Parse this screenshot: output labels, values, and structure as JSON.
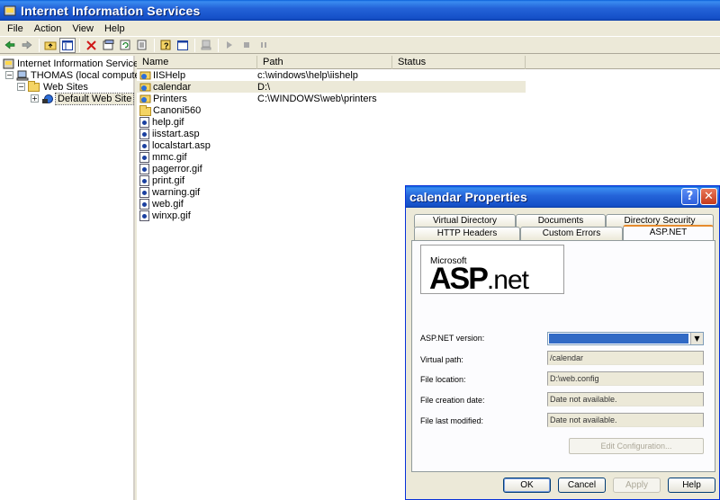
{
  "window": {
    "title": "Internet Information Services"
  },
  "menu": [
    "File",
    "Action",
    "View",
    "Help"
  ],
  "toolbar_icons": [
    "back-arrow-icon",
    "forward-arrow-icon",
    "up-folder-icon",
    "show-hide-tree-icon",
    "delete-icon",
    "properties-icon",
    "refresh-icon",
    "export-list-icon",
    "help-icon",
    "console-icon",
    "computer-icon",
    "play-icon",
    "stop-icon",
    "pause-icon"
  ],
  "tree": {
    "root": "Internet Information Services",
    "computer": "THOMAS (local computer)",
    "websites": "Web Sites",
    "default_site": "Default Web Site"
  },
  "list": {
    "columns": [
      "Name",
      "Path",
      "Status"
    ],
    "rows": [
      {
        "name": "IISHelp",
        "path": "c:\\windows\\help\\iishelp",
        "icon": "vdir"
      },
      {
        "name": "calendar",
        "path": "D:\\",
        "icon": "vdir"
      },
      {
        "name": "Printers",
        "path": "C:\\WINDOWS\\web\\printers",
        "icon": "vdir"
      },
      {
        "name": "Canoni560",
        "path": "",
        "icon": "folder"
      },
      {
        "name": "help.gif",
        "path": "",
        "icon": "file"
      },
      {
        "name": "iisstart.asp",
        "path": "",
        "icon": "file"
      },
      {
        "name": "localstart.asp",
        "path": "",
        "icon": "file"
      },
      {
        "name": "mmc.gif",
        "path": "",
        "icon": "file"
      },
      {
        "name": "pagerror.gif",
        "path": "",
        "icon": "file"
      },
      {
        "name": "print.gif",
        "path": "",
        "icon": "file"
      },
      {
        "name": "warning.gif",
        "path": "",
        "icon": "file"
      },
      {
        "name": "web.gif",
        "path": "",
        "icon": "file"
      },
      {
        "name": "winxp.gif",
        "path": "",
        "icon": "file"
      }
    ]
  },
  "dialog": {
    "title": "calendar Properties",
    "help_glyph": "?",
    "close_glyph": "✕",
    "tabs_row1": [
      "Virtual Directory",
      "Documents",
      "Directory Security"
    ],
    "tabs_row2": [
      "HTTP Headers",
      "Custom Errors",
      "ASP.NET"
    ],
    "logo_ms": "Microsoft",
    "logo_asp": "ASP",
    "logo_net": ".net",
    "fields": [
      {
        "label": "ASP.NET version:",
        "value": ""
      },
      {
        "label": "Virtual path:",
        "value": "/calendar"
      },
      {
        "label": "File location:",
        "value": "D:\\web.config"
      },
      {
        "label": "File creation date:",
        "value": "Date not available."
      },
      {
        "label": "File last modified:",
        "value": "Date not available."
      }
    ],
    "edit_config": "Edit Configuration...",
    "buttons": [
      "OK",
      "Cancel",
      "Apply",
      "Help"
    ],
    "select_arrow": "▼"
  },
  "tree_expanders": {
    "minus": "−",
    "plus": "+"
  }
}
